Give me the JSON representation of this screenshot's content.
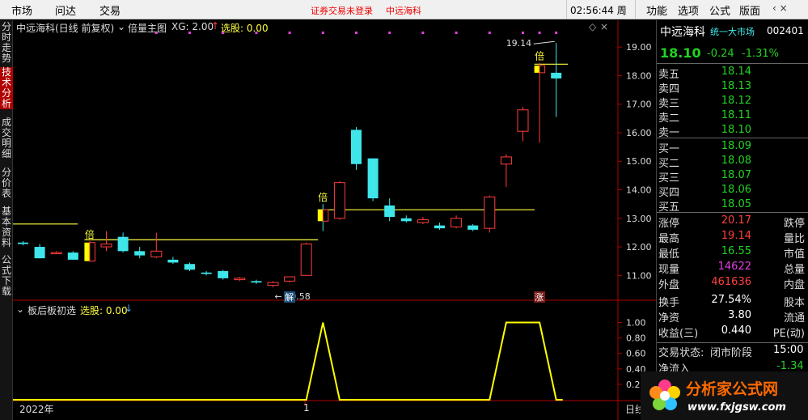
{
  "menubar": {
    "items": [
      "市场",
      "问达",
      "交易"
    ],
    "login_status": "证券交易未登录",
    "stock_name": "中远海科",
    "clock": "02:56:44 周三",
    "right_items": [
      "功能",
      "选项",
      "公式",
      "版面"
    ],
    "win_buttons": "‹ ×"
  },
  "left_tabs": [
    "分时走势",
    "技术分析",
    "成交明细",
    "分价表",
    "基本资料",
    "公式下载"
  ],
  "main_chart": {
    "title": "中远海科(日线 前复权)",
    "indicator": "倍量主图",
    "xg_label": "XG: 2.00",
    "xg_arrow": "↑",
    "select_label": "选股: 0.00",
    "high_label": "19.14",
    "low_label": "10.58",
    "bei_label": "倍",
    "jie_label": "解",
    "zhang_label": "涨",
    "y_ticks": [
      "19.00",
      "18.00",
      "17.00",
      "16.00",
      "15.00",
      "14.00",
      "13.00",
      "12.00",
      "11.00"
    ]
  },
  "sub_chart": {
    "title": "板后板初选",
    "select_label": "选股: 0.00",
    "select_arrow": "↓",
    "y_ticks": [
      "1.00",
      "0.80",
      "0.60",
      "0.40",
      "0.20"
    ],
    "x_label_year": "2022年",
    "x_label_month": "1",
    "x_label_day": "日线"
  },
  "chart_data": [
    {
      "type": "candlestick",
      "title": "中远海科(日线 前复权)",
      "ylim": [
        10.3,
        19.6
      ],
      "candles": [
        {
          "o": 12.1,
          "h": 12.2,
          "l": 12.05,
          "c": 12.15,
          "up": false
        },
        {
          "o": 12.0,
          "h": 12.1,
          "l": 11.6,
          "c": 11.6,
          "up": false
        },
        {
          "o": 11.8,
          "h": 11.85,
          "l": 11.75,
          "c": 11.8,
          "up": true
        },
        {
          "o": 11.8,
          "h": 11.85,
          "l": 11.55,
          "c": 11.55,
          "up": false
        },
        {
          "o": 11.5,
          "h": 12.2,
          "l": 11.5,
          "c": 12.15,
          "up": true
        },
        {
          "o": 12.1,
          "h": 12.55,
          "l": 11.85,
          "c": 12.0,
          "up": true
        },
        {
          "o": 12.35,
          "h": 12.5,
          "l": 11.8,
          "c": 11.85,
          "up": false
        },
        {
          "o": 11.85,
          "h": 12.0,
          "l": 11.6,
          "c": 11.7,
          "up": false
        },
        {
          "o": 11.65,
          "h": 12.5,
          "l": 11.6,
          "c": 11.85,
          "up": true
        },
        {
          "o": 11.55,
          "h": 11.65,
          "l": 11.4,
          "c": 11.45,
          "up": false
        },
        {
          "o": 11.4,
          "h": 11.45,
          "l": 11.15,
          "c": 11.2,
          "up": false
        },
        {
          "o": 11.1,
          "h": 11.15,
          "l": 11.0,
          "c": 11.05,
          "up": false
        },
        {
          "o": 11.15,
          "h": 11.2,
          "l": 10.85,
          "c": 10.9,
          "up": false
        },
        {
          "o": 10.85,
          "h": 10.95,
          "l": 10.8,
          "c": 10.9,
          "up": true
        },
        {
          "o": 10.8,
          "h": 10.85,
          "l": 10.7,
          "c": 10.75,
          "up": false
        },
        {
          "o": 10.65,
          "h": 10.8,
          "l": 10.58,
          "c": 10.75,
          "up": true
        },
        {
          "o": 10.8,
          "h": 10.95,
          "l": 10.75,
          "c": 10.95,
          "up": true
        },
        {
          "o": 11.0,
          "h": 12.15,
          "l": 11.0,
          "c": 12.1,
          "up": true
        },
        {
          "o": 13.3,
          "h": 13.5,
          "l": 12.55,
          "c": 12.9,
          "up": false
        },
        {
          "o": 13.0,
          "h": 14.3,
          "l": 12.95,
          "c": 14.25,
          "up": true
        },
        {
          "o": 14.9,
          "h": 16.2,
          "l": 14.7,
          "c": 16.1,
          "up": false
        },
        {
          "o": 15.1,
          "h": 15.1,
          "l": 13.6,
          "c": 13.7,
          "up": false
        },
        {
          "o": 13.45,
          "h": 13.7,
          "l": 12.9,
          "c": 13.05,
          "up": false
        },
        {
          "o": 13.0,
          "h": 13.1,
          "l": 12.85,
          "c": 12.9,
          "up": false
        },
        {
          "o": 12.95,
          "h": 13.05,
          "l": 12.8,
          "c": 12.85,
          "up": true
        },
        {
          "o": 12.75,
          "h": 12.85,
          "l": 12.6,
          "c": 12.65,
          "up": false
        },
        {
          "o": 12.7,
          "h": 13.1,
          "l": 12.65,
          "c": 13.0,
          "up": true
        },
        {
          "o": 12.75,
          "h": 12.8,
          "l": 12.55,
          "c": 12.6,
          "up": false
        },
        {
          "o": 12.65,
          "h": 13.8,
          "l": 12.5,
          "c": 13.75,
          "up": true
        },
        {
          "o": 14.9,
          "h": 15.25,
          "l": 14.1,
          "c": 15.15,
          "up": true
        },
        {
          "o": 16.8,
          "h": 16.9,
          "l": 15.7,
          "c": 16.05,
          "up": true
        },
        {
          "o": 18.35,
          "h": 18.45,
          "l": 15.65,
          "c": 18.1,
          "up": true
        },
        {
          "o": 17.9,
          "h": 19.14,
          "l": 16.55,
          "c": 18.1,
          "up": false
        }
      ],
      "bei_candles": [
        4,
        18,
        31
      ],
      "bei_lines": [
        {
          "from": 4,
          "to": 17,
          "value": 12.25
        },
        {
          "from": 18,
          "to": 30,
          "value": 13.3
        },
        {
          "from": 31,
          "to": 32,
          "value": 18.4
        }
      ],
      "left_line": {
        "value": 12.8
      },
      "dot_markers": [
        8,
        10,
        12,
        14,
        16,
        18,
        20,
        22,
        24,
        26,
        28,
        30,
        31,
        32
      ]
    },
    {
      "type": "line",
      "title": "板后板初选",
      "ylim": [
        0,
        1.1
      ],
      "values": [
        0,
        0,
        0,
        0,
        0,
        0,
        0,
        0,
        0,
        0,
        0,
        0,
        0,
        0,
        0,
        0,
        0,
        0,
        1,
        0,
        0,
        0,
        0,
        0,
        0,
        0,
        0,
        0,
        0,
        1,
        1,
        1,
        0
      ]
    }
  ],
  "right_panel": {
    "stock_name": "中远海科",
    "market": "统一大市场",
    "code": "002401",
    "price": "18.10",
    "change": "-0.24",
    "change_pct": "-1.31%",
    "asks": [
      {
        "label": "卖五",
        "price": "18.14"
      },
      {
        "label": "卖四",
        "price": "18.13"
      },
      {
        "label": "卖三",
        "price": "18.12"
      },
      {
        "label": "卖二",
        "price": "18.11"
      },
      {
        "label": "卖一",
        "price": "18.10"
      }
    ],
    "bids": [
      {
        "label": "买一",
        "price": "18.09"
      },
      {
        "label": "买二",
        "price": "18.08"
      },
      {
        "label": "买三",
        "price": "18.07"
      },
      {
        "label": "买四",
        "price": "18.06"
      },
      {
        "label": "买五",
        "price": "18.05"
      }
    ],
    "stats": [
      {
        "label": "涨停",
        "value": "20.17",
        "right": "跌停",
        "color": "red"
      },
      {
        "label": "最高",
        "value": "19.14",
        "right": "量比",
        "color": "red"
      },
      {
        "label": "最低",
        "value": "16.55",
        "right": "市值",
        "color": "green"
      },
      {
        "label": "现量",
        "value": "14622",
        "right": "总量",
        "color": "magenta"
      },
      {
        "label": "外盘",
        "value": "461636",
        "right": "内盘",
        "color": "red"
      },
      {
        "label": "换手",
        "value": "27.54%",
        "right": "股本",
        "color": "white"
      },
      {
        "label": "净资",
        "value": "3.80",
        "right": "流通",
        "color": "white"
      },
      {
        "label": "收益(三)",
        "value": "0.440",
        "right": "PE(动)",
        "color": "white"
      }
    ],
    "trade_status_label": "交易状态:",
    "trade_status": "闭市阶段",
    "trade_time": "15:00",
    "net_inflow_label": "净流入",
    "net_inflow": "-1.34"
  },
  "logo": {
    "text": "分析家公式网",
    "url_text": "www.fxjgsw.com"
  }
}
